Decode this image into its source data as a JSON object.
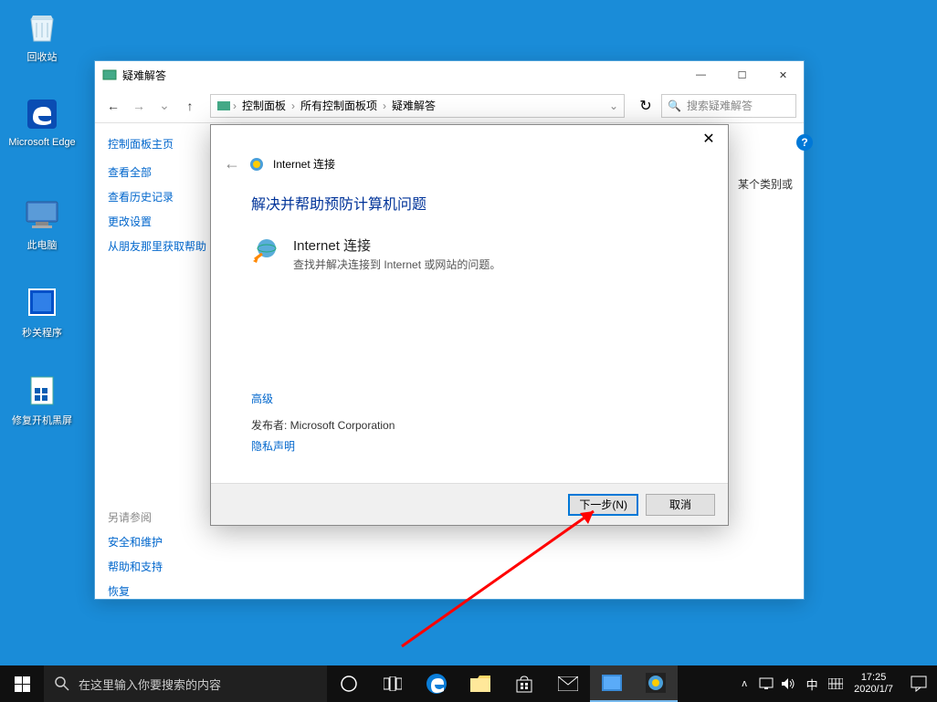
{
  "desktop": {
    "icons": [
      {
        "name": "recycle-bin",
        "label": "回收站"
      },
      {
        "name": "edge",
        "label": "Microsoft Edge"
      },
      {
        "name": "this-pc",
        "label": "此电脑"
      },
      {
        "name": "sec-shutdown",
        "label": "秒关程序"
      },
      {
        "name": "fix-blackscreen",
        "label": "修复开机黑屏"
      }
    ]
  },
  "cp_window": {
    "title": "疑难解答",
    "breadcrumb": [
      "控制面板",
      "所有控制面板项",
      "疑难解答"
    ],
    "search_placeholder": "搜索疑难解答",
    "sidebar": {
      "main": "控制面板主页",
      "links": [
        "查看全部",
        "查看历史记录",
        "更改设置",
        "从朋友那里获取帮助"
      ],
      "section_label": "另请参阅",
      "section_links": [
        "安全和维护",
        "帮助和支持",
        "恢复"
      ]
    },
    "side_text": "某个类别或"
  },
  "dialog": {
    "header_title": "Internet 连接",
    "heading": "解决并帮助预防计算机问题",
    "item_title": "Internet 连接",
    "item_desc": "查找并解决连接到 Internet 或网站的问题。",
    "advanced_link": "高级",
    "publisher": "发布者:  Microsoft Corporation",
    "privacy_link": "隐私声明",
    "next_btn": "下一步(N)",
    "cancel_btn": "取消"
  },
  "taskbar": {
    "search_placeholder": "在这里输入你要搜索的内容",
    "ime": "中",
    "time": "17:25",
    "date": "2020/1/7"
  }
}
